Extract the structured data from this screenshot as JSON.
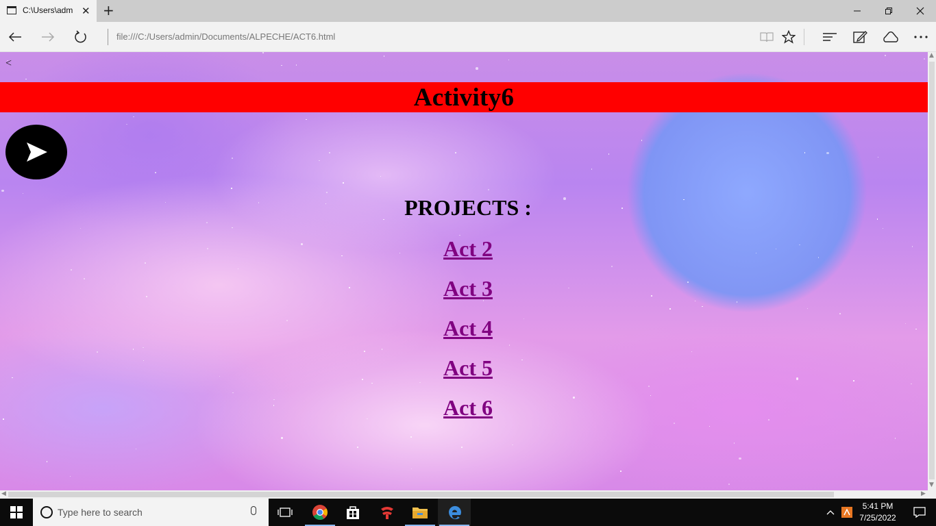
{
  "browser": {
    "tab_title": "C:\\Users\\adm",
    "new_tab_symbol": "+",
    "tab_close_symbol": "✕",
    "address": "file:///C:/Users/admin/Documents/ALPECHE/ACT6.html"
  },
  "page": {
    "back_link": "<",
    "banner_title": "Activity6",
    "banner_color": "#ff0000",
    "play_button_icon": "play-icon",
    "projects_heading": "PROJECTS :",
    "links": [
      {
        "label": "Act 2"
      },
      {
        "label": "Act 3"
      },
      {
        "label": "Act 4"
      },
      {
        "label": "Act 5"
      },
      {
        "label": "Act 6"
      }
    ],
    "link_color": "#800080"
  },
  "taskbar": {
    "search_placeholder": "Type here to search",
    "time": "5:41 PM",
    "date": "7/25/2022",
    "apps": [
      "task-view-icon",
      "chrome-icon",
      "store-icon",
      "game-app-icon",
      "file-explorer-icon",
      "edge-icon"
    ]
  }
}
